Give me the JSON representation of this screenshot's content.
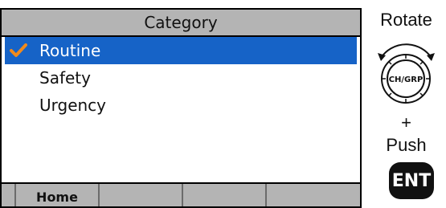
{
  "screen": {
    "title": "Category",
    "items": [
      {
        "label": "Routine",
        "selected": true
      },
      {
        "label": "Safety",
        "selected": false
      },
      {
        "label": "Urgency",
        "selected": false
      }
    ],
    "softkeys": [
      "Home",
      "",
      "",
      ""
    ]
  },
  "side": {
    "rotate_label": "Rotate",
    "dial_label": "CH/GRP",
    "plus_label": "+",
    "push_label": "Push",
    "ent_label": "ENT"
  },
  "colors": {
    "selection": "#1663c7",
    "check": "#f08a1c",
    "bar": "#b4b4b4"
  },
  "icons": {
    "check": "check-icon",
    "dial": "dial-knob-icon"
  }
}
